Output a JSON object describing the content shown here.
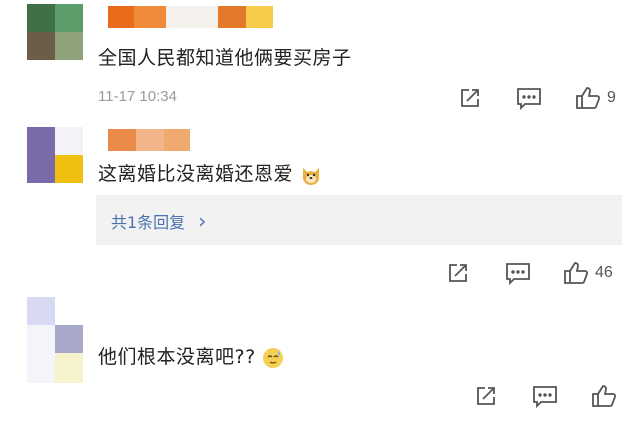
{
  "comments": [
    {
      "text": "全国人民都知道他俩要买房子",
      "timestamp": "11-17 10:34",
      "like_count": "9",
      "avatar_colors": [
        "#3f7048",
        "#5b9c6a",
        "#6b5d48",
        "#8fa37a"
      ],
      "name_colors": [
        "#e86a1a",
        "#ef8a3a",
        "#f4f1ec",
        "#e27a2a",
        "#f7cc4a"
      ],
      "icons": [
        "share-icon",
        "comment-icon",
        "like-icon"
      ]
    },
    {
      "text": "这离婚比没离婚还恩爱",
      "emoji": "doge-emoji",
      "reply_label": "共1条回复",
      "reply_arrow": "›",
      "like_count": "46",
      "avatar_colors": [
        "#7b6aa8",
        "#f4f1f8",
        "#7b6aa8",
        "#f0c010"
      ],
      "name_colors": [
        "#e98a48",
        "#f3b48a",
        "#f0aa70"
      ],
      "icons": [
        "share-icon",
        "comment-icon",
        "like-icon"
      ]
    },
    {
      "text": "他们根本没离吧??",
      "emoji": "sweat-smile-emoji",
      "avatar_colors": [
        "#d8daf4",
        "#a8a8c8",
        "#f5f2cc"
      ],
      "icons": [
        "share-icon",
        "comment-icon",
        "like-icon"
      ]
    }
  ],
  "colors": {
    "link_blue": "#4a72b0",
    "reply_bg": "#f2f2f2",
    "meta_gray": "#9a9a9a"
  }
}
